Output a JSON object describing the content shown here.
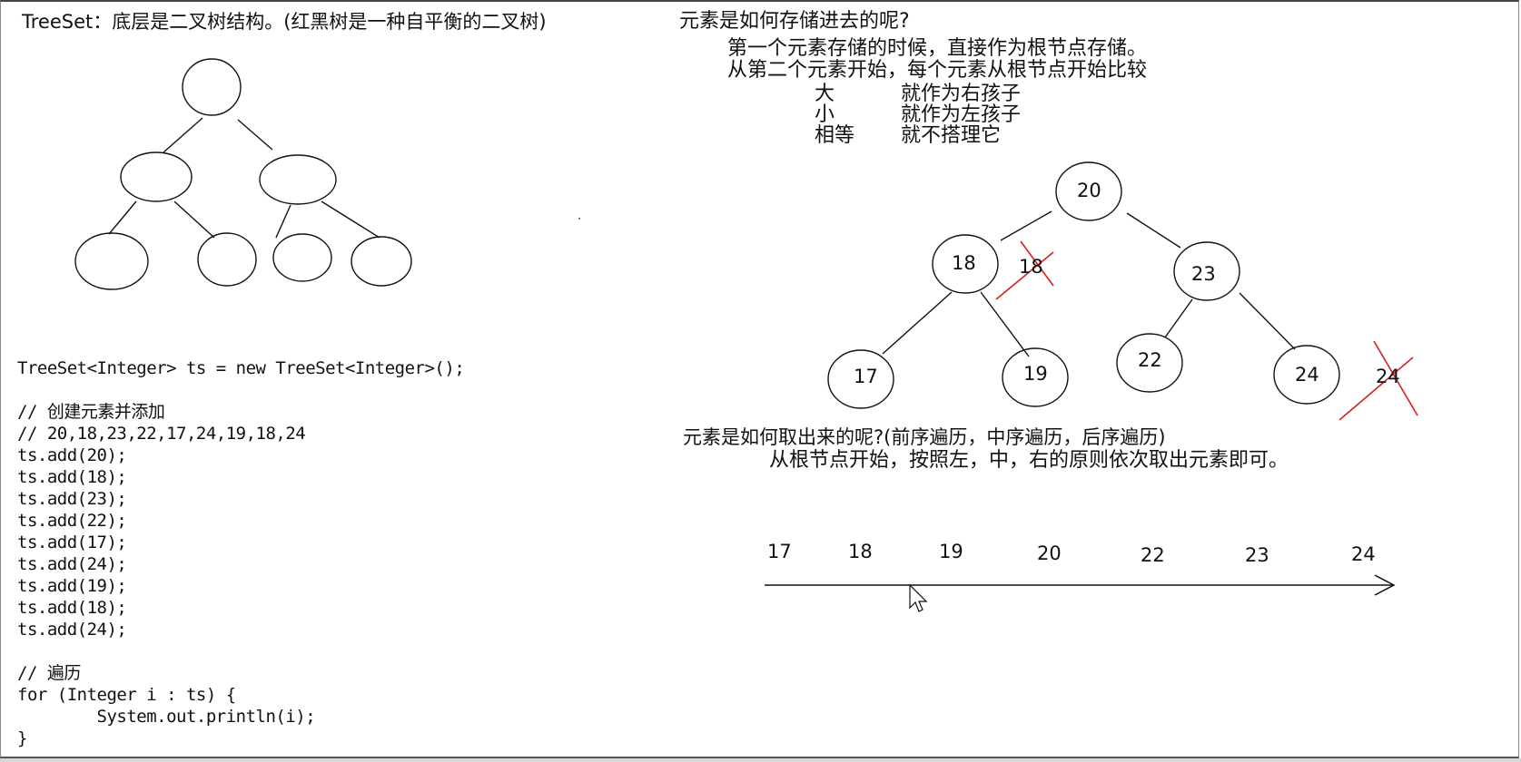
{
  "left": {
    "title": "TreeSet：底层是二叉树结构。(红黑树是一种自平衡的二叉树)",
    "code_lines": [
      "TreeSet<Integer> ts = new TreeSet<Integer>();",
      "",
      "// 创建元素并添加",
      "// 20,18,23,22,17,24,19,18,24",
      "ts.add(20);",
      "ts.add(18);",
      "ts.add(23);",
      "ts.add(22);",
      "ts.add(17);",
      "ts.add(24);",
      "ts.add(19);",
      "ts.add(18);",
      "ts.add(24);",
      "",
      "// 遍历",
      "for (Integer i : ts) {",
      "        System.out.println(i);",
      "}"
    ]
  },
  "right": {
    "store_title": "元素是如何存储进去的呢?",
    "store_line1": "第一个元素存储的时候，直接作为根节点存储。",
    "store_line2": "从第二个元素开始，每个元素从根节点开始比较",
    "rules": [
      {
        "key": "大",
        "action": "就作为右孩子"
      },
      {
        "key": "小",
        "action": "就作为左孩子"
      },
      {
        "key": "相等",
        "action": "就不搭理它"
      }
    ],
    "tree_nodes": {
      "root": "20",
      "left": "18",
      "right": "23",
      "left_left": "17",
      "left_right": "19",
      "right_left": "22",
      "right_right": "24"
    },
    "rejected": {
      "dup1": "18",
      "dup2": "24"
    },
    "retrieve_title": "元素是如何取出来的呢?(前序遍历，中序遍历，后序遍历)",
    "retrieve_line": "从根节点开始，按照左，中，右的原则依次取出元素即可。",
    "sequence": [
      "17",
      "18",
      "19",
      "20",
      "22",
      "23",
      "24"
    ]
  },
  "colors": {
    "ink": "#111111",
    "cross_red": "#d42020"
  }
}
